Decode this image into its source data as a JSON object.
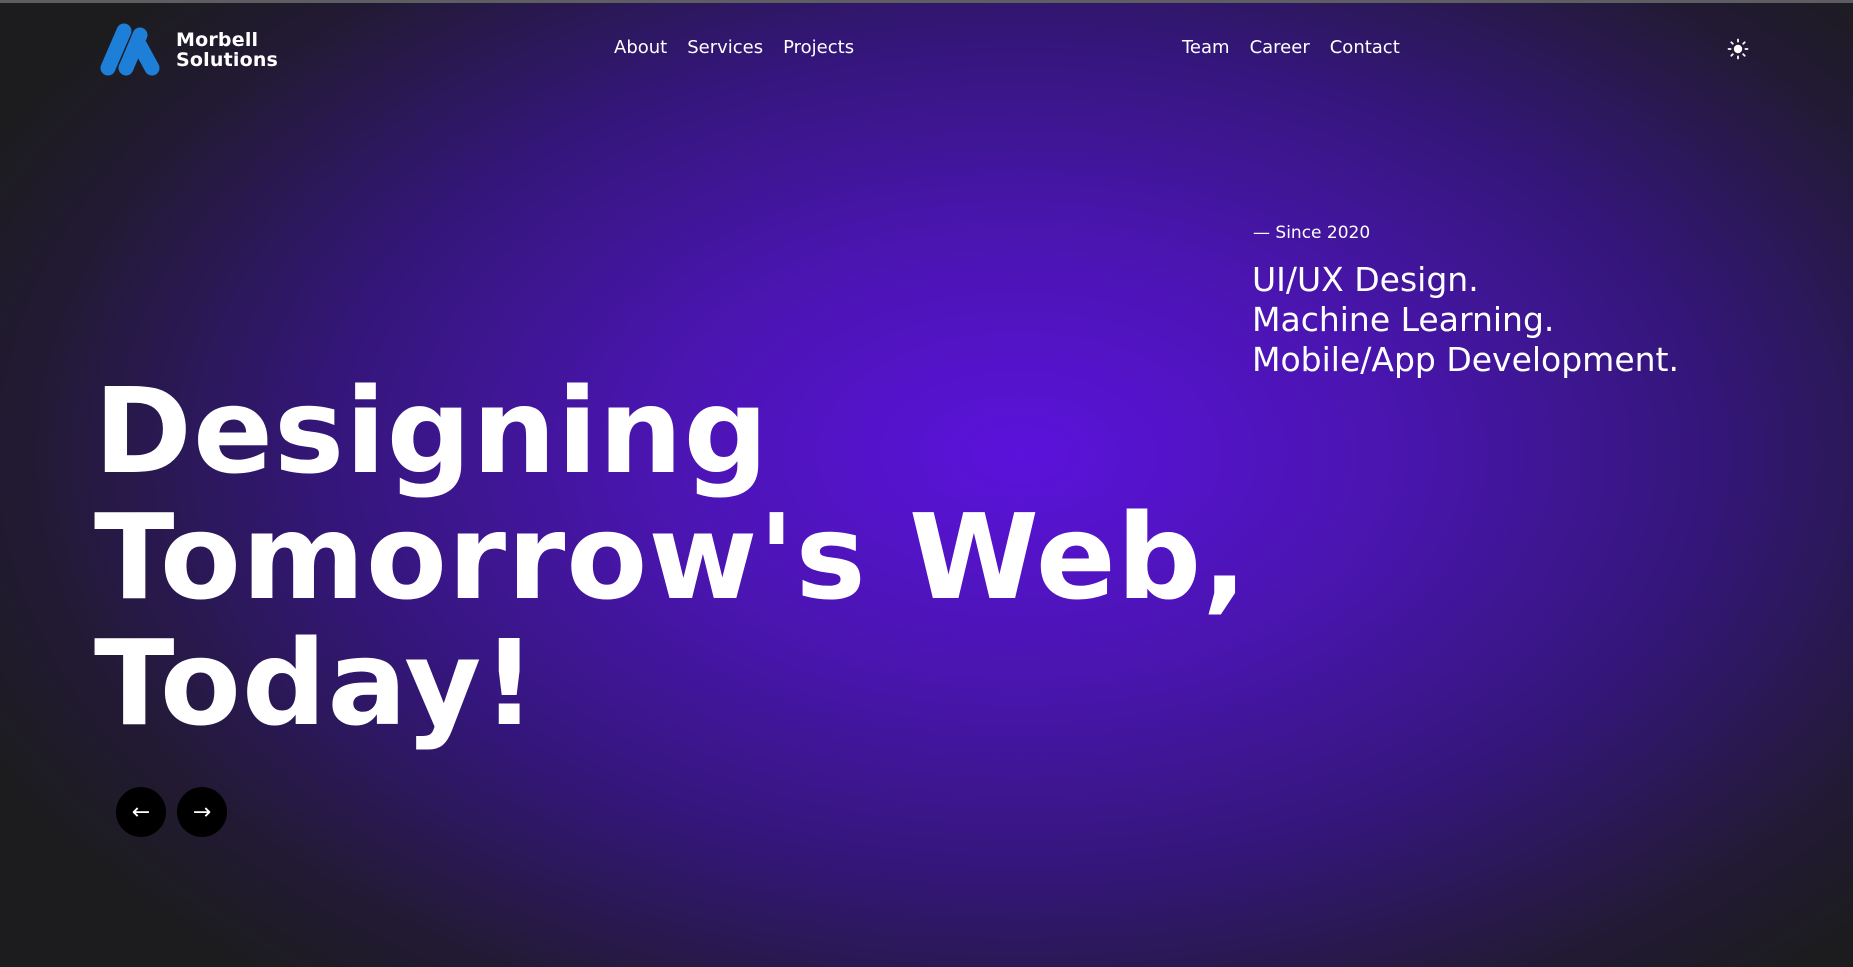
{
  "brand": {
    "name_line1": "Morbell",
    "name_line2": "Solutions",
    "logo_color": "#1e7fd8"
  },
  "nav": {
    "left": [
      "About",
      "Services",
      "Projects"
    ],
    "right": [
      "Team",
      "Career",
      "Contact"
    ]
  },
  "theme_toggle": {
    "icon": "sun-icon"
  },
  "intro": {
    "since": "— Since 2020",
    "services": [
      "UI/UX Design.",
      "Machine Learning.",
      "Mobile/App Development."
    ]
  },
  "hero": {
    "lines": [
      "Designing",
      "Tomorrow's Web,",
      "Today!"
    ]
  },
  "slider": {
    "prev": "←",
    "next": "→"
  },
  "colors": {
    "background_center": "#5b12db",
    "background_edge": "#1c1c1e",
    "text": "#ffffff",
    "button": "#000000"
  }
}
